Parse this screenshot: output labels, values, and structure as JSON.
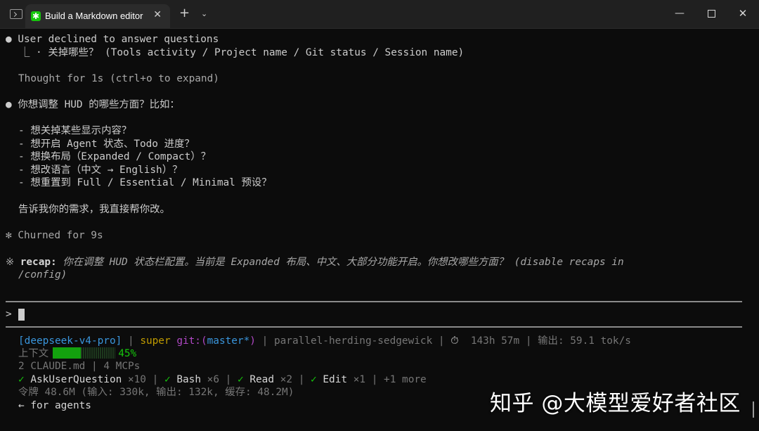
{
  "window": {
    "tab_title": "Build a Markdown editor",
    "tab_icon_glyph": "✱",
    "tab_close": "✕",
    "new_tab": "+",
    "tab_dropdown": "⌄",
    "minimize": "—",
    "close": "✕",
    "accent": "#16c60c"
  },
  "conversation": {
    "declined_bullet": "●",
    "declined_text": "User declined to answer questions",
    "declined_detail": "⎿ · 关掉哪些？ (Tools activity / Project name / Git status / Session name)",
    "thought": "Thought for 1s (ctrl+o to expand)",
    "question_bullet": "●",
    "question": "你想调整 HUD 的哪些方面？比如：",
    "options": [
      "- 想关掉某些显示内容？",
      "- 想开启 Agent 状态、Todo 进度？",
      "- 想换布局（Expanded / Compact）？",
      "- 想改语言（中文 → English）？",
      "- 想重置到 Full / Essential / Minimal 预设？"
    ],
    "closing": "告诉我你的需求，我直接帮你改。",
    "churned_icon": "✻",
    "churned": "Churned for 9s",
    "recap_icon": "※",
    "recap_label": "recap:",
    "recap_text": "你在调整 HUD 状态栏配置。当前是 Expanded 布局、中文、大部分功能开启。你想改哪些方面？ (disable recaps in",
    "recap_text2": "/config)"
  },
  "prompt": {
    "symbol": ">"
  },
  "statusbar": {
    "model": "[deepseek-v4-pro]",
    "sep": "|",
    "project": "super",
    "git_label": "git:(",
    "git_branch": "master*",
    "git_close": ")",
    "session": "parallel-herding-sedgewick",
    "timer_icon": "⏱",
    "duration": "143h 57m",
    "output_label": "输出: 59.1 tok/s",
    "context_label": "上下文",
    "context_percent": 45,
    "context_percent_text": "45%",
    "claude_md": "2 CLAUDE.md",
    "mcps": "4 MCPs",
    "check": "✓",
    "tools": [
      {
        "name": "AskUserQuestion",
        "count": "×10"
      },
      {
        "name": "Bash",
        "count": "×6"
      },
      {
        "name": "Read",
        "count": "×2"
      },
      {
        "name": "Edit",
        "count": "×1"
      }
    ],
    "more": "+1 more",
    "tokens": "令牌 48.6M (输入: 330k, 输出: 132k, 缓存: 48.2M)",
    "agents": "← for agents"
  },
  "watermark": "知乎 @大模型爱好者社区"
}
